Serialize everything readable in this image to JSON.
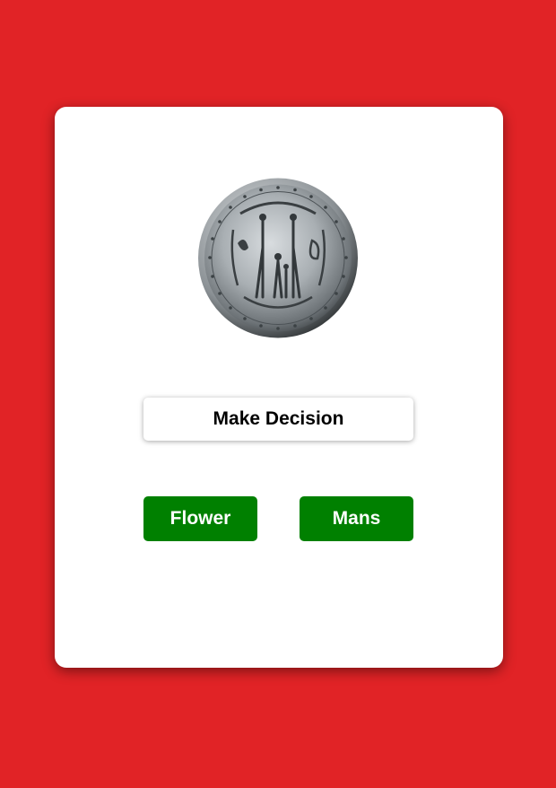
{
  "colors": {
    "page_background": "#e12326",
    "card_background": "#ffffff",
    "choice_button": "#008000",
    "choice_button_text": "#ffffff"
  },
  "coin": {
    "icon": "coin-icon"
  },
  "decision": {
    "label": "Make Decision"
  },
  "choices": {
    "flower_label": "Flower",
    "mans_label": "Mans"
  }
}
